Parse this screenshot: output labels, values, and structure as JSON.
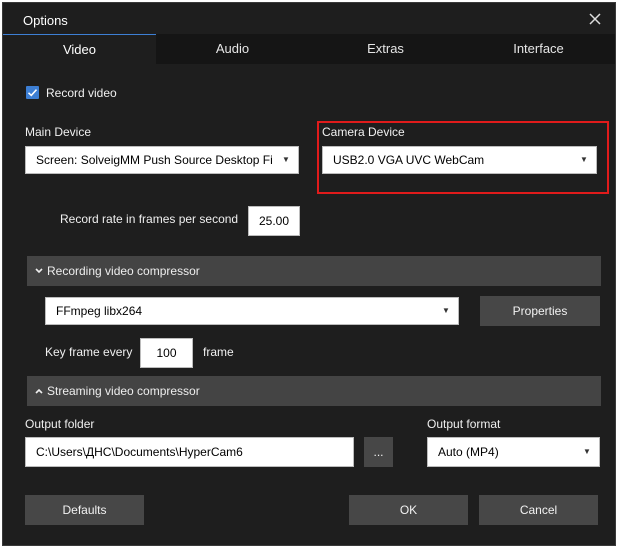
{
  "window": {
    "title": "Options"
  },
  "tabs": [
    {
      "label": "Video",
      "active": true
    },
    {
      "label": "Audio",
      "active": false
    },
    {
      "label": "Extras",
      "active": false
    },
    {
      "label": "Interface",
      "active": false
    }
  ],
  "record_video": {
    "label": "Record video",
    "checked": true
  },
  "main_device": {
    "label": "Main Device",
    "value": "Screen: SolveigMM Push Source Desktop Fi"
  },
  "camera_device": {
    "label": "Camera Device",
    "value": "USB2.0 VGA UVC WebCam"
  },
  "frame_rate": {
    "label": "Record rate in frames per second",
    "value": "25.00"
  },
  "recording_compressor": {
    "header": "Recording video compressor",
    "codec": "FFmpeg libx264",
    "properties_label": "Properties",
    "key_frame_label": "Key frame every",
    "key_frame_value": "100",
    "key_frame_unit": "frame"
  },
  "streaming_compressor": {
    "header": "Streaming video compressor"
  },
  "output_folder": {
    "label": "Output folder",
    "value": "C:\\Users\\ДНС\\Documents\\HyperCam6",
    "browse_label": "..."
  },
  "output_format": {
    "label": "Output format",
    "value": "Auto (MP4)"
  },
  "buttons": {
    "defaults": "Defaults",
    "ok": "OK",
    "cancel": "Cancel"
  },
  "colors": {
    "accent": "#3d7fd4",
    "highlight": "#e01b1b",
    "background": "#1e1e1e",
    "section": "#444444",
    "button": "#474747"
  }
}
